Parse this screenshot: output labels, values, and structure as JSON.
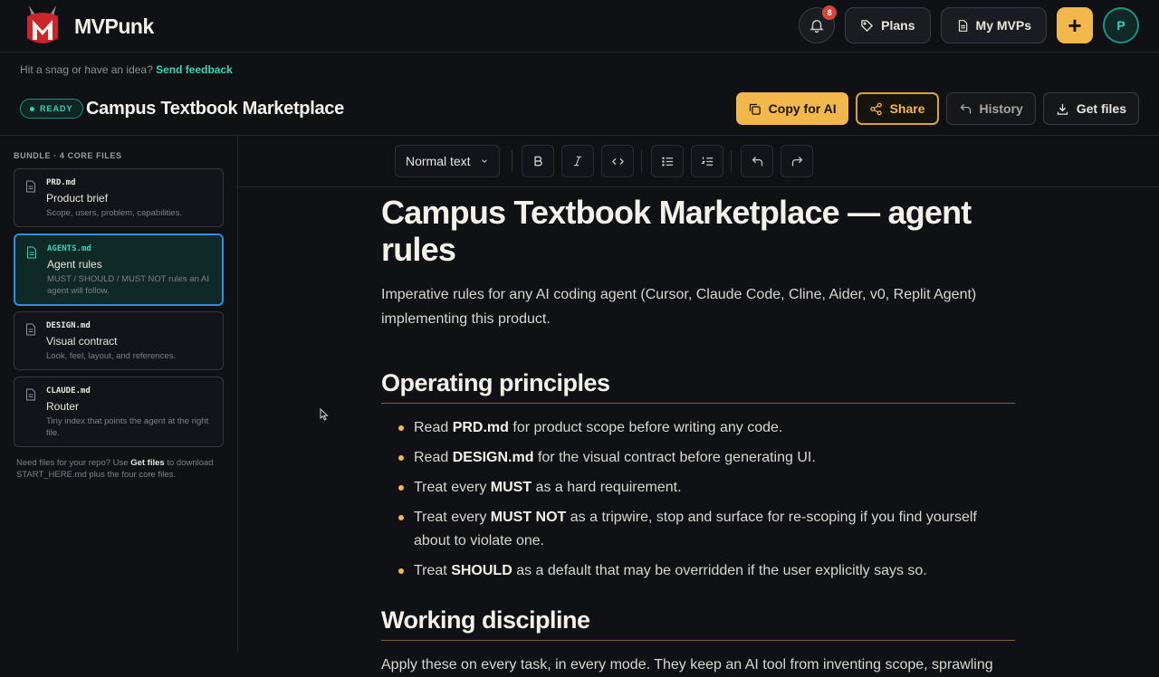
{
  "app": {
    "brand": "MVPunk",
    "notification_count": "8"
  },
  "topnav": {
    "plans_label": "Plans",
    "my_mvps_label": "My MVPs",
    "plus_label": "+",
    "avatar_initial": "P"
  },
  "feedback": {
    "prompt": "Hit a snag or have an idea?",
    "link": "Send feedback"
  },
  "doc": {
    "status": "READY",
    "title": "Campus Textbook Marketplace",
    "actions": {
      "copy_ai": "Copy for AI",
      "share": "Share",
      "history": "History",
      "get_files": "Get files"
    }
  },
  "sidebar": {
    "bundle_label": "BUNDLE · 4 CORE FILES",
    "files": [
      {
        "name": "PRD.md",
        "title": "Product brief",
        "desc": "Scope, users, problem, capabilities."
      },
      {
        "name": "AGENTS.md",
        "title": "Agent rules",
        "desc": "MUST / SHOULD / MUST NOT rules an AI agent will follow."
      },
      {
        "name": "DESIGN.md",
        "title": "Visual contract",
        "desc": "Look, feel, layout, and references."
      },
      {
        "name": "CLAUDE.md",
        "title": "Router",
        "desc": "Tiny index that points the agent at the right file."
      }
    ],
    "note_before": "Need files for your repo? Use ",
    "note_link": "Get files",
    "note_after": " to download START_HERE.md plus the four core files."
  },
  "toolbar": {
    "text_style": "Normal text"
  },
  "content": {
    "h1": "Campus Textbook Marketplace — agent rules",
    "intro": "Imperative rules for any AI coding agent (Cursor, Claude Code, Cline, Aider, v0, Replit Agent) implementing this product.",
    "section1": {
      "heading": "Operating principles",
      "items": [
        {
          "pre": "Read ",
          "bold": "PRD.md",
          "post": " for product scope before writing any code."
        },
        {
          "pre": "Read ",
          "bold": "DESIGN.md",
          "post": " for the visual contract before generating UI."
        },
        {
          "pre": "Treat every ",
          "bold": "MUST",
          "post": " as a hard requirement."
        },
        {
          "pre": "Treat every ",
          "bold": "MUST NOT",
          "post": " as a tripwire, stop and surface for re-scoping if you find yourself about to violate one."
        },
        {
          "pre": "Treat ",
          "bold": "SHOULD",
          "post": " as a default that may be overridden if the user explicitly says so."
        }
      ]
    },
    "section2": {
      "heading": "Working discipline",
      "para": "Apply these on every task, in every mode. They keep an AI tool from inventing scope, sprawling"
    }
  }
}
